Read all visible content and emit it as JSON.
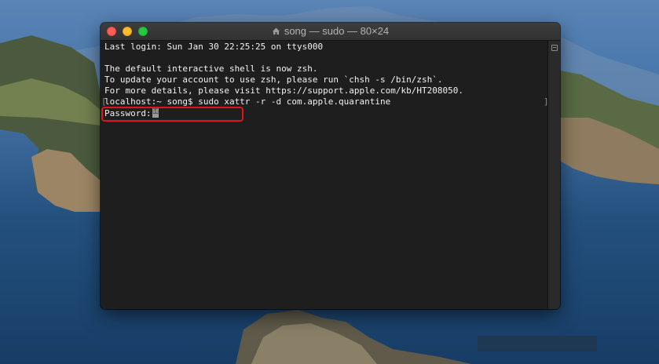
{
  "window": {
    "title": "song — sudo — 80×24",
    "title_icon": "home-folder-icon"
  },
  "terminal": {
    "lines": [
      "Last login: Sun Jan 30 22:25:25 on ttys000",
      "",
      "The default interactive shell is now zsh.",
      "To update your account to use zsh, please run `chsh -s /bin/zsh`.",
      "For more details, please visit https://support.apple.com/kb/HT208050.",
      "localhost:~ song$ sudo xattr -r -d com.apple.quarantine",
      "Password:"
    ],
    "cursor_icon": "key-icon"
  },
  "colors": {
    "terminal_bg": "#1e1e1e",
    "terminal_text": "#f2f2f2",
    "highlight_box": "#e0141b",
    "close": "#fd5f57",
    "minimize": "#febc2e",
    "maximize": "#28c840"
  }
}
